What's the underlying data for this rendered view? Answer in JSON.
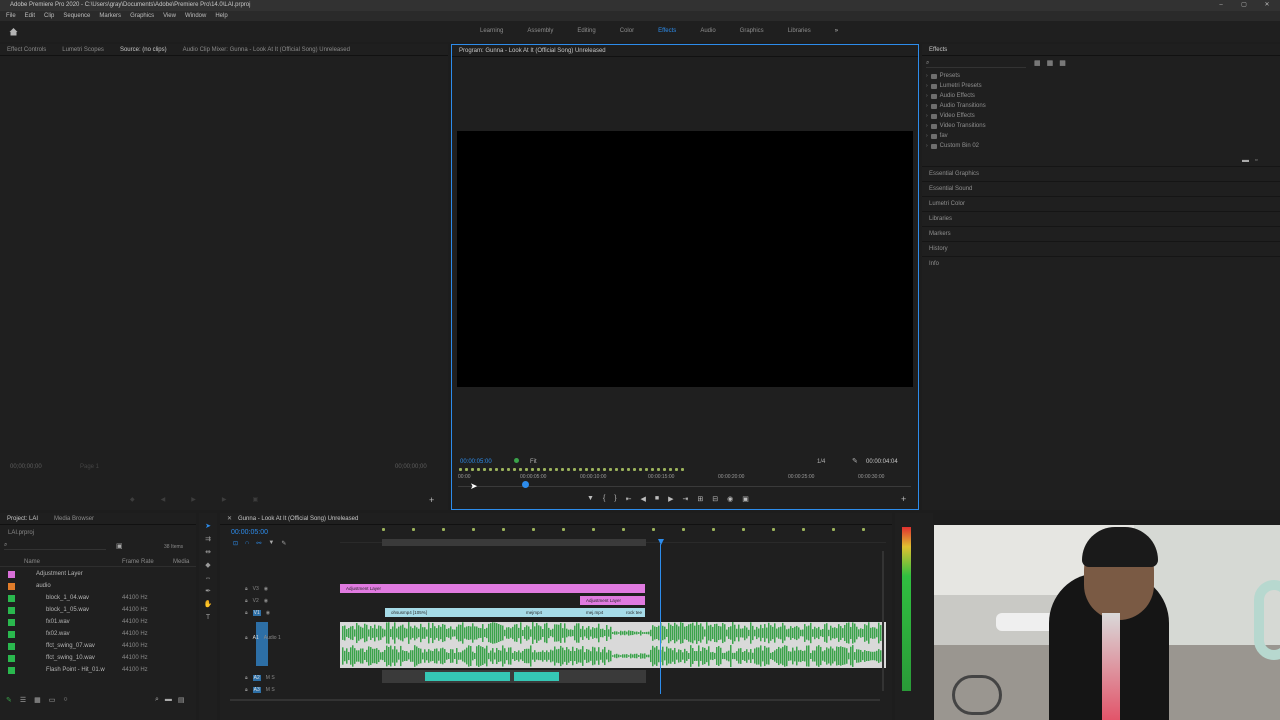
{
  "window": {
    "title": "Adobe Premiere Pro 2020 - C:\\Users\\gray\\Documents\\Adobe\\Premiere Pro\\14.0\\LAI.prproj",
    "controls": [
      "–",
      "▢",
      "✕"
    ]
  },
  "menu": [
    "File",
    "Edit",
    "Clip",
    "Sequence",
    "Markers",
    "Graphics",
    "View",
    "Window",
    "Help"
  ],
  "workspaces": {
    "tabs": [
      "Learning",
      "Assembly",
      "Editing",
      "Color",
      "Effects",
      "Audio",
      "Graphics",
      "Libraries"
    ],
    "active": "Effects",
    "more": "»"
  },
  "source_panel": {
    "tabs": [
      "Effect Controls",
      "Lumetri Scopes",
      "Source: (no clips)",
      "Audio Clip Mixer: Gunna - Look At It (Official Song) Unreleased"
    ],
    "timecode_left": "00;00;00;00",
    "page_label": "Page 1",
    "timecode_right": "00;00;00;00"
  },
  "program_monitor": {
    "title": "Program: Gunna - Look At It (Official Song) Unreleased",
    "timecode": "00:00:05:00",
    "fit": "Fit",
    "resolution": "1/4",
    "duration": "00:00:04:04",
    "ruler": [
      "00:00",
      "00:00:05:00",
      "00:00:10:00",
      "00:00:15:00",
      "00:00:20:00",
      "00:00:25:00",
      "00:00:30:00"
    ]
  },
  "effects_panel": {
    "title": "Effects",
    "items": [
      "Presets",
      "Lumetri Presets",
      "Audio Effects",
      "Audio Transitions",
      "Video Effects",
      "Video Transitions",
      "fav",
      "Custom Bin 02"
    ]
  },
  "side_panels": [
    "Essential Graphics",
    "Essential Sound",
    "Lumetri Color",
    "Libraries",
    "Markers",
    "History",
    "Info"
  ],
  "project_panel": {
    "tabs": [
      "Project: LAI",
      "Media Browser"
    ],
    "project_file": "LAI.prproj",
    "item_count": "38 Items",
    "columns": [
      "Name",
      "Frame Rate",
      "Media"
    ],
    "rows": [
      {
        "name": "Adjustment Layer",
        "rate": "",
        "color": "#d86fd8"
      },
      {
        "name": "audio",
        "rate": "",
        "color": "#e07c2a"
      },
      {
        "name": "block_1_04.wav",
        "rate": "44100 Hz",
        "color": "#2ab84e"
      },
      {
        "name": "block_1_05.wav",
        "rate": "44100 Hz",
        "color": "#2ab84e"
      },
      {
        "name": "fx01.wav",
        "rate": "44100 Hz",
        "color": "#2ab84e"
      },
      {
        "name": "fx02.wav",
        "rate": "44100 Hz",
        "color": "#2ab84e"
      },
      {
        "name": "ffct_swing_07.wav",
        "rate": "44100 Hz",
        "color": "#2ab84e"
      },
      {
        "name": "ffct_swing_10.wav",
        "rate": "44100 Hz",
        "color": "#2ab84e"
      },
      {
        "name": "Flash Point - Hit_01.w",
        "rate": "44100 Hz",
        "color": "#2ab84e"
      }
    ]
  },
  "timeline": {
    "title": "Gunna - Look At It (Official Song) Unreleased",
    "timecode": "00:00:05:00",
    "tracks": [
      "V3",
      "V2",
      "V1",
      "A1",
      "A2",
      "A3"
    ],
    "track_name": "Audio 1",
    "clips": {
      "v3": "Adjustment Layer",
      "v2": "Adjustment Layer",
      "v1a": "ohsusmp4 [105%]",
      "v1b": "mejmp4",
      "v1c": "mej.mp4",
      "v1d": "rock tee"
    }
  },
  "colors": {
    "accent": "#2d8ceb",
    "adjustment": "#e07ae0",
    "video_clip": "#a6dbe8",
    "audio_clip": "#3aa34a"
  }
}
